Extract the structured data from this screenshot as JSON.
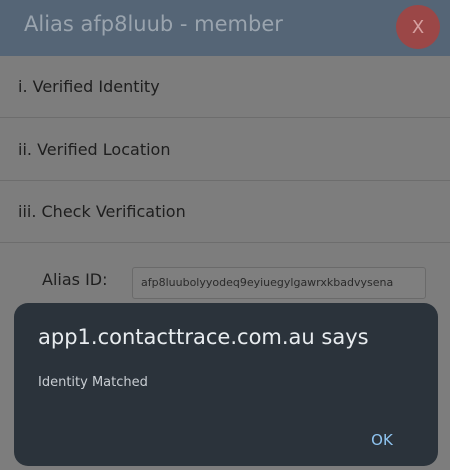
{
  "header": {
    "title": "Alias afp8luub - member",
    "close_label": "X"
  },
  "rows": [
    {
      "label": "i. Verified Identity"
    },
    {
      "label": "ii. Verified Location"
    },
    {
      "label": "iii. Check Verification"
    }
  ],
  "alias": {
    "label": "Alias ID:",
    "value": "afp8luubolyyodeq9eyiuegylgawrxkbadvysena"
  },
  "dialog": {
    "title": "app1.contacttrace.com.au says",
    "message": "Identity Matched",
    "ok_label": "OK"
  },
  "colors": {
    "header": "#556576",
    "close_button": "#9b4747",
    "dialog_bg": "#2b333b",
    "dialog_button": "#8fc4f0"
  }
}
